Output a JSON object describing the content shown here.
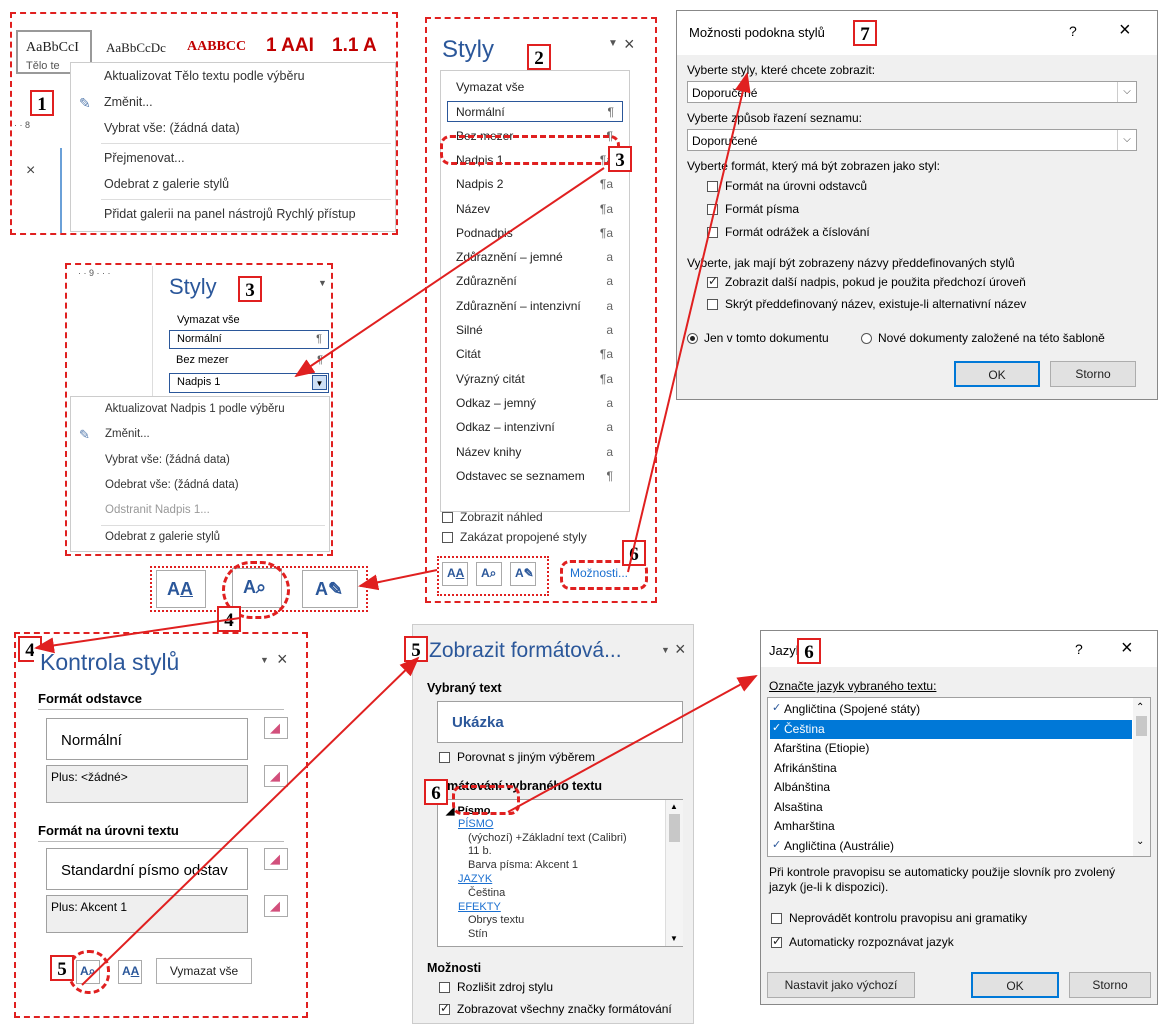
{
  "panel1": {
    "gallery_items": [
      "AaBbCcI",
      "AaBbCcDc",
      "AABBCC",
      "1 AAI",
      "1.1 A"
    ],
    "gallery_label": "Tělo te",
    "menu": [
      {
        "label": "Aktualizovat Tělo textu podle výběru"
      },
      {
        "label": "Změnit..."
      },
      {
        "label": "Vybrat vše: (žádná data)"
      },
      {
        "label": "Přejmenovat..."
      },
      {
        "label": "Odebrat z galerie stylů"
      },
      {
        "label": "Přidat galerii na panel nástrojů Rychlý přístup"
      }
    ],
    "ruler": "· · 8",
    "close": "×"
  },
  "panel2": {
    "title": "Styly",
    "styles": [
      {
        "name": "Vymazat vše",
        "sym": ""
      },
      {
        "name": "Normální",
        "sym": "¶"
      },
      {
        "name": "Bez mezer",
        "sym": "¶"
      },
      {
        "name": "Nadpis 1",
        "sym": "¶a"
      },
      {
        "name": "Nadpis 2",
        "sym": "¶a"
      },
      {
        "name": "Název",
        "sym": "¶a"
      },
      {
        "name": "Podnadpis",
        "sym": "¶a"
      },
      {
        "name": "Zdůraznění – jemné",
        "sym": "a"
      },
      {
        "name": "Zdůraznění",
        "sym": "a"
      },
      {
        "name": "Zdůraznění – intenzivní",
        "sym": "a"
      },
      {
        "name": "Silné",
        "sym": "a"
      },
      {
        "name": "Citát",
        "sym": "¶a"
      },
      {
        "name": "Výrazný citát",
        "sym": "¶a"
      },
      {
        "name": "Odkaz – jemný",
        "sym": "a"
      },
      {
        "name": "Odkaz – intenzivní",
        "sym": "a"
      },
      {
        "name": "Název knihy",
        "sym": "a"
      },
      {
        "name": "Odstavec se seznamem",
        "sym": "¶"
      }
    ],
    "show_preview": "Zobrazit náhled",
    "disable_linked": "Zakázat propojené styly",
    "options_link": "Možnosti..."
  },
  "panel3": {
    "title": "Styly",
    "ruler": "· · 9 · · ·",
    "styles": [
      {
        "name": "Vymazat vše",
        "sym": ""
      },
      {
        "name": "Normální",
        "sym": "¶"
      },
      {
        "name": "Bez mezer",
        "sym": "¶"
      },
      {
        "name": "Nadpis 1",
        "sym": ""
      }
    ],
    "menu": [
      {
        "label": "Aktualizovat Nadpis 1 podle výběru"
      },
      {
        "label": "Změnit..."
      },
      {
        "label": "Vybrat vše: (žádná data)"
      },
      {
        "label": "Odebrat vše: (žádná data)"
      },
      {
        "label": "Odstranit Nadpis 1..."
      },
      {
        "label": "Odebrat z galerie stylů"
      }
    ]
  },
  "panel4": {
    "title": "Kontrola stylů",
    "para_heading": "Formát odstavce",
    "para_value": "Normální",
    "para_plus": "Plus: <žádné>",
    "text_heading": "Formát na úrovni textu",
    "text_value": "Standardní písmo odstav",
    "text_plus": "Plus: Akcent 1",
    "clear_all": "Vymazat vše"
  },
  "panel5": {
    "title": "Zobrazit formátová...",
    "selected_heading": "Vybraný text",
    "sample": "Ukázka",
    "compare": "Porovnat s jiným výběrem",
    "formatting_heading": "Formátování vybraného textu",
    "tree": [
      {
        "text": "◢ Písmo",
        "kind": "head"
      },
      {
        "text": "PÍSMO",
        "kind": "link"
      },
      {
        "text": "(výchozí) +Základní text (Calibri)",
        "kind": "val"
      },
      {
        "text": "11 b.",
        "kind": "val"
      },
      {
        "text": "Barva písma: Akcent 1",
        "kind": "val"
      },
      {
        "text": "JAZYK",
        "kind": "link"
      },
      {
        "text": "Čeština",
        "kind": "val"
      },
      {
        "text": "EFEKTY",
        "kind": "link"
      },
      {
        "text": "Obrys textu",
        "kind": "val"
      },
      {
        "text": "Stín",
        "kind": "val"
      }
    ],
    "options_heading": "Možnosti",
    "distinguish": "Rozlišit zdroj stylu",
    "show_all_marks": "Zobrazovat všechny značky formátování"
  },
  "dialog7": {
    "title": "Možnosti podokna stylů",
    "help": "?",
    "close": "×",
    "select_label": "Vyberte styly, které chcete zobrazit:",
    "select_value": "Doporučené",
    "sort_label": "Vyberte způsob řazení seznamu:",
    "sort_value": "Doporučené",
    "format_label": "Vyberte formát, který má být zobrazen jako styl:",
    "checks1": [
      {
        "label": "Formát na úrovni odstavců",
        "on": false
      },
      {
        "label": "Formát písma",
        "on": false
      },
      {
        "label": "Formát odrážek a číslování",
        "on": false
      }
    ],
    "names_label": "Vyberte, jak mají být zobrazeny názvy předdefinovaných stylů",
    "checks2": [
      {
        "label": "Zobrazit další nadpis, pokud je použita předchozí úroveň",
        "on": true
      },
      {
        "label": "Skrýt předdefinovaný název, existuje-li alternativní název",
        "on": false
      }
    ],
    "radio1": "Jen v tomto dokumentu",
    "radio2": "Nové dokumenty založené na této šabloně",
    "ok": "OK",
    "cancel": "Storno"
  },
  "dialog6": {
    "title": "Jazyk",
    "help": "?",
    "close": "×",
    "label": "Označte jazyk vybraného textu:",
    "languages": [
      {
        "name": "Angličtina (Spojené státy)",
        "spell": true,
        "selected": false
      },
      {
        "name": "Čeština",
        "spell": true,
        "selected": true
      },
      {
        "name": "Afarština (Etiopie)",
        "spell": false,
        "selected": false
      },
      {
        "name": "Afrikánština",
        "spell": false,
        "selected": false
      },
      {
        "name": "Albánština",
        "spell": false,
        "selected": false
      },
      {
        "name": "Alsaština",
        "spell": false,
        "selected": false
      },
      {
        "name": "Amharština",
        "spell": false,
        "selected": false
      },
      {
        "name": "Angličtina (Austrálie)",
        "spell": true,
        "selected": false
      }
    ],
    "info": "Při kontrole pravopisu se automaticky použije slovník pro zvolený jazyk (je-li k dispozici).",
    "no_check": "Neprovádět kontrolu pravopisu ani gramatiky",
    "auto_detect": "Automaticky rozpoznávat jazyk",
    "set_default": "Nastavit jako výchozí",
    "ok": "OK",
    "cancel": "Storno"
  },
  "badges": {
    "b1": "1",
    "b2": "2",
    "b3": "3",
    "b4": "4",
    "b5": "5",
    "b6": "6",
    "b7": "7"
  },
  "colors": {
    "accent": "#e02020",
    "link": "#1a6fd0",
    "selection": "#0078d7",
    "heading_blue": "#2b579a"
  }
}
